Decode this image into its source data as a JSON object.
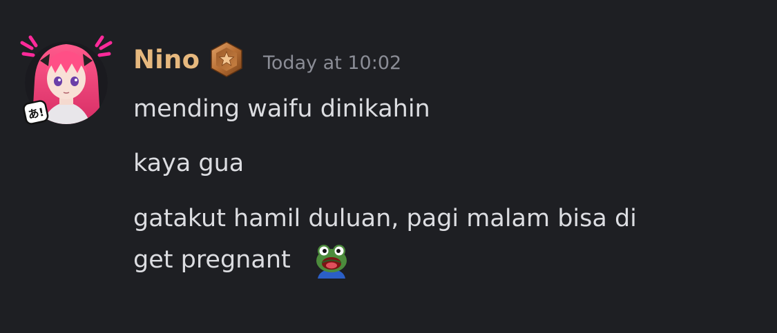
{
  "message": {
    "author": {
      "name": "Nino",
      "name_color": "#e6b87e",
      "avatar": "anime-girl-avatar",
      "avatar_decoration": "avatar-decoration-a-kana",
      "decoration_text": "あ!",
      "badge": "bronze-star-badge-icon"
    },
    "timestamp": "Today at 10:02",
    "lines": [
      "mending waifu dinikahin",
      "kaya gua",
      "gatakut hamil duluan, pagi malam bisa di",
      "get pregnant"
    ],
    "emote": "poggers-frog-emote"
  },
  "colors": {
    "background": "#1e1f23",
    "text": "#dcdde1",
    "timestamp": "#8b8d96",
    "decoration_accent": "#ff2a9a"
  }
}
